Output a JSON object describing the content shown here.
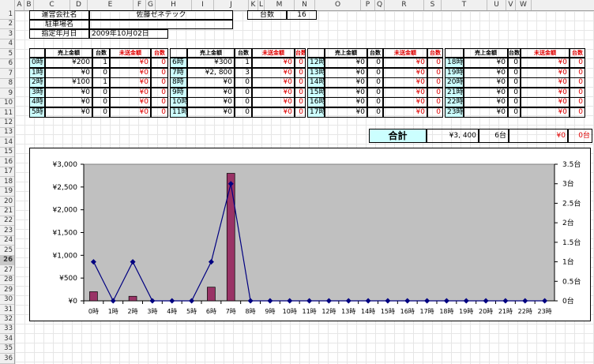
{
  "column_headers": [
    "A",
    "B",
    "C",
    "D",
    "E",
    "F",
    "G",
    "H",
    "I",
    "J",
    "K",
    "L",
    "M",
    "N",
    "O",
    "P",
    "Q",
    "R",
    "S",
    "T",
    "U",
    "V",
    "W"
  ],
  "row_numbers": [
    "1",
    "2",
    "3",
    "4",
    "5",
    "6",
    "7",
    "8",
    "9",
    "10",
    "11",
    "12",
    "13",
    "14",
    "15",
    "16",
    "17",
    "18",
    "19",
    "20",
    "21",
    "22",
    "23",
    "24",
    "25",
    "26",
    "27",
    "28",
    "29",
    "30",
    "31",
    "32",
    "33",
    "34",
    "35",
    "36"
  ],
  "selected_row": "26",
  "info": {
    "company_label": "運営会社名",
    "company_value": "佐藤ゼネテック",
    "parking_label": "駐車場名",
    "parking_value": "",
    "date_label": "指定年月日",
    "date_value": "2009年10月02日",
    "count_label": "台数",
    "count_value": "16"
  },
  "table_headers": {
    "sales": "売上金額",
    "units": "台数",
    "unsent": "未送金額",
    "unsent_units": "台数"
  },
  "hour_blocks": [
    {
      "rows": [
        {
          "hour": "0時",
          "sales": "¥200",
          "units": "1",
          "unsent": "¥0",
          "unsent_units": "0"
        },
        {
          "hour": "1時",
          "sales": "¥0",
          "units": "0",
          "unsent": "¥0",
          "unsent_units": "0"
        },
        {
          "hour": "2時",
          "sales": "¥100",
          "units": "1",
          "unsent": "¥0",
          "unsent_units": "0"
        },
        {
          "hour": "3時",
          "sales": "¥0",
          "units": "0",
          "unsent": "¥0",
          "unsent_units": "0"
        },
        {
          "hour": "4時",
          "sales": "¥0",
          "units": "0",
          "unsent": "¥0",
          "unsent_units": "0"
        },
        {
          "hour": "5時",
          "sales": "¥0",
          "units": "0",
          "unsent": "¥0",
          "unsent_units": "0"
        }
      ]
    },
    {
      "rows": [
        {
          "hour": "6時",
          "sales": "¥300",
          "units": "1",
          "unsent": "¥0",
          "unsent_units": "0"
        },
        {
          "hour": "7時",
          "sales": "¥2, 800",
          "units": "3",
          "unsent": "¥0",
          "unsent_units": "0"
        },
        {
          "hour": "8時",
          "sales": "¥0",
          "units": "0",
          "unsent": "¥0",
          "unsent_units": "0"
        },
        {
          "hour": "9時",
          "sales": "¥0",
          "units": "0",
          "unsent": "¥0",
          "unsent_units": "0"
        },
        {
          "hour": "10時",
          "sales": "¥0",
          "units": "0",
          "unsent": "¥0",
          "unsent_units": "0"
        },
        {
          "hour": "11時",
          "sales": "¥0",
          "units": "0",
          "unsent": "¥0",
          "unsent_units": "0"
        }
      ]
    },
    {
      "rows": [
        {
          "hour": "12時",
          "sales": "¥0",
          "units": "0",
          "unsent": "¥0",
          "unsent_units": "0"
        },
        {
          "hour": "13時",
          "sales": "¥0",
          "units": "0",
          "unsent": "¥0",
          "unsent_units": "0"
        },
        {
          "hour": "14時",
          "sales": "¥0",
          "units": "0",
          "unsent": "¥0",
          "unsent_units": "0"
        },
        {
          "hour": "15時",
          "sales": "¥0",
          "units": "0",
          "unsent": "¥0",
          "unsent_units": "0"
        },
        {
          "hour": "16時",
          "sales": "¥0",
          "units": "0",
          "unsent": "¥0",
          "unsent_units": "0"
        },
        {
          "hour": "17時",
          "sales": "¥0",
          "units": "0",
          "unsent": "¥0",
          "unsent_units": "0"
        }
      ]
    },
    {
      "rows": [
        {
          "hour": "18時",
          "sales": "¥0",
          "units": "0",
          "unsent": "¥0",
          "unsent_units": "0"
        },
        {
          "hour": "19時",
          "sales": "¥0",
          "units": "0",
          "unsent": "¥0",
          "unsent_units": "0"
        },
        {
          "hour": "20時",
          "sales": "¥0",
          "units": "0",
          "unsent": "¥0",
          "unsent_units": "0"
        },
        {
          "hour": "21時",
          "sales": "¥0",
          "units": "0",
          "unsent": "¥0",
          "unsent_units": "0"
        },
        {
          "hour": "22時",
          "sales": "¥0",
          "units": "0",
          "unsent": "¥0",
          "unsent_units": "0"
        },
        {
          "hour": "23時",
          "sales": "¥0",
          "units": "0",
          "unsent": "¥0",
          "unsent_units": "0"
        }
      ]
    }
  ],
  "totals": {
    "label": "合計",
    "sales": "¥3, 400",
    "units": "6台",
    "unsent": "¥0",
    "unsent_units": "0台"
  },
  "colors": {
    "header_cyan": "#ccffff",
    "bar": "#993366",
    "line": "#000080",
    "plot_bg": "#c0c0c0",
    "unsent_red": "#e00000"
  },
  "chart_data": {
    "type": "bar",
    "categories": [
      "0時",
      "1時",
      "2時",
      "3時",
      "4時",
      "5時",
      "6時",
      "7時",
      "8時",
      "9時",
      "10時",
      "11時",
      "12時",
      "13時",
      "14時",
      "15時",
      "16時",
      "17時",
      "18時",
      "19時",
      "20時",
      "21時",
      "22時",
      "23時"
    ],
    "series": [
      {
        "axis": "left",
        "kind": "bar",
        "values": [
          200,
          0,
          100,
          0,
          0,
          0,
          300,
          2800,
          0,
          0,
          0,
          0,
          0,
          0,
          0,
          0,
          0,
          0,
          0,
          0,
          0,
          0,
          0,
          0
        ]
      },
      {
        "axis": "right",
        "kind": "line",
        "values": [
          1,
          0,
          1,
          0,
          0,
          0,
          1,
          3,
          0,
          0,
          0,
          0,
          0,
          0,
          0,
          0,
          0,
          0,
          0,
          0,
          0,
          0,
          0,
          0
        ]
      }
    ],
    "ylim_left": [
      0,
      3000
    ],
    "ylim_right": [
      0,
      3.5
    ],
    "left_ticks": [
      "¥0",
      "¥500",
      "¥1,000",
      "¥1,500",
      "¥2,000",
      "¥2,500",
      "¥3,000"
    ],
    "right_ticks": [
      "0台",
      "0.5台",
      "1台",
      "1.5台",
      "2台",
      "2.5台",
      "3台",
      "3.5台"
    ],
    "grid": false
  }
}
